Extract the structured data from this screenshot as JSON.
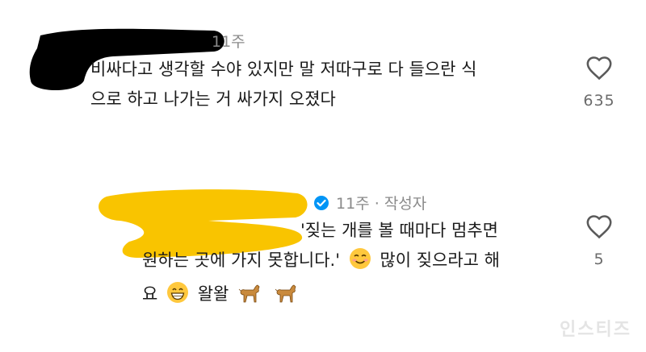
{
  "comments": [
    {
      "username": "",
      "time": "11주",
      "lines": [
        "비싸다고 생각할 수야 있지만 말 저따구로 다 들으란 식",
        "으로 하고 나가는 거 싸가지 오졌다"
      ],
      "like_count": "635"
    },
    {
      "username": "",
      "time": "11주",
      "author_tag": "작성자",
      "separator": "·",
      "line1": "'짖는 개를 볼 때마다 멈추면",
      "line2a": "원하는 곳에 가지 못합니다.'",
      "line2b": "많이 짖으라고 해",
      "line3a": "요",
      "line3b": "왈왈",
      "like_count": "5"
    }
  ],
  "watermark": "인스티즈",
  "colors": {
    "redaction_black": "#000000",
    "redaction_yellow": "#f9c400",
    "verified_blue": "#0095f6",
    "heart_gray": "#5a5a5a"
  },
  "icons": [
    "heart-icon",
    "verified-badge-icon",
    "smiling-face-icon",
    "grinning-face-icon",
    "dog-icon"
  ]
}
